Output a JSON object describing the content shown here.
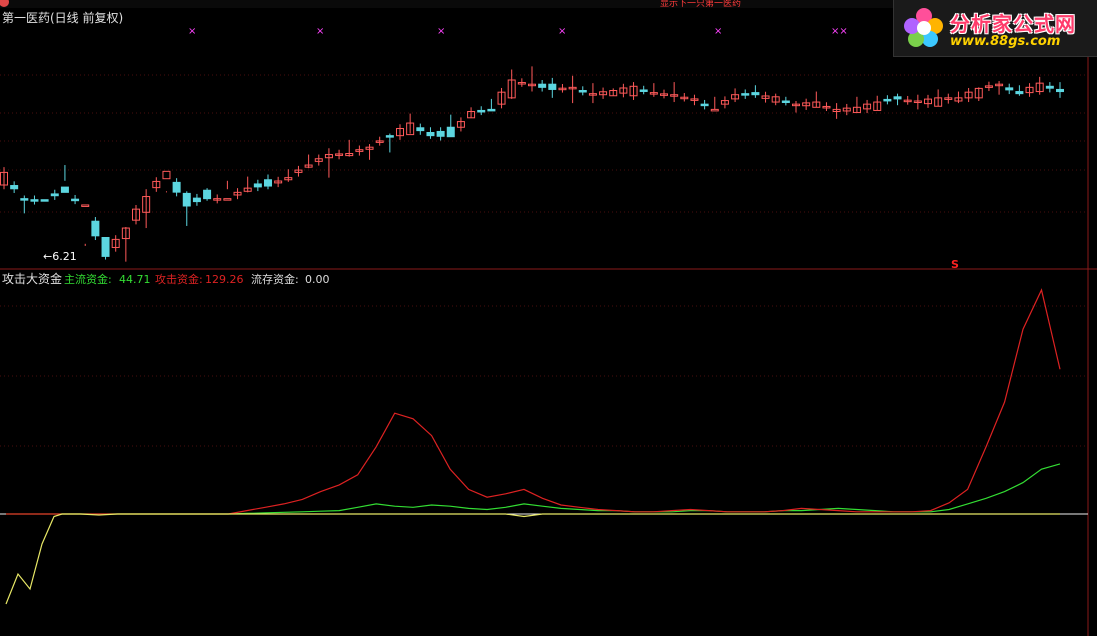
{
  "window": {
    "title": "第一医药(日线 前复权)",
    "top_menu_text": "显示下一只第一医药"
  },
  "logo": {
    "brand": "分析家公式网",
    "url": "www.88gs.com",
    "flower_icon": "flower-logo-icon"
  },
  "price_panel": {
    "low_marker_label": "←6.21",
    "signal_mark": "S",
    "x_marks": [
      "×",
      "×",
      "×",
      "×",
      "×",
      "××"
    ]
  },
  "indicator_panel": {
    "name": "攻击大资金",
    "legend": [
      {
        "label": "主流资金:",
        "value": "44.71",
        "color": "#33dd33"
      },
      {
        "label": "攻击资金:",
        "value": "129.26",
        "color": "#dd2222"
      },
      {
        "label": "流存资金:",
        "value": "0.00",
        "color": "#dddd44"
      }
    ]
  },
  "colors": {
    "up_candle": "#ff5a5a",
    "down_candle": "#5cd6e0",
    "grid": "#3a0000",
    "zero_line": "#ffffff",
    "text": "#e0e0e0",
    "x_mark": "#ff44ff"
  },
  "chart_data": [
    {
      "type": "candlestick",
      "title": "第一医药(日线 前复权)",
      "annotations": [
        "6.21"
      ],
      "candles": [
        [
          0,
          0.0,
          0.12,
          -0.04,
          0.17
        ],
        [
          1,
          -0.13,
          -0.14,
          -0.1,
          -0.27
        ],
        [
          2,
          -0.14,
          -0.15,
          -0.04,
          -0.04
        ],
        [
          3,
          -0.02,
          -0.07,
          0.19,
          0.04
        ],
        [
          4,
          -0.2,
          -0.19,
          -0.58,
          -0.56
        ],
        [
          5,
          -0.5,
          -0.68,
          -0.5,
          -0.71
        ],
        [
          6,
          -0.51,
          -0.41,
          -0.4,
          -0.73
        ],
        [
          7,
          -0.26,
          -0.11,
          -0.04,
          -0.41
        ],
        [
          8,
          0.06,
          0.13,
          -0.07,
          -0.06
        ],
        [
          9,
          -0.08,
          -0.2,
          -0.06,
          -0.39
        ],
        [
          10,
          -0.05,
          -0.13,
          -0.03,
          -0.15
        ],
        [
          11,
          -0.14,
          -0.13,
          0.04,
          -0.04
        ],
        [
          12,
          -0.06,
          -0.03,
          0.08,
          -0.07
        ],
        [
          13,
          0.05,
          -0.01,
          0.1,
          -0.04
        ],
        [
          14,
          0.05,
          0.07,
          0.15,
          0.03
        ],
        [
          15,
          0.17,
          0.19,
          0.29,
          0.16
        ],
        [
          16,
          0.26,
          0.29,
          0.35,
          0.07
        ],
        [
          17,
          0.28,
          0.3,
          0.43,
          0.27
        ],
        [
          18,
          0.34,
          0.36,
          0.39,
          0.24
        ],
        [
          19,
          0.47,
          0.46,
          0.49,
          0.31
        ],
        [
          20,
          0.48,
          0.59,
          0.68,
          0.49
        ],
        [
          21,
          0.5,
          0.47,
          0.55,
          0.44
        ],
        [
          22,
          0.55,
          0.46,
          0.67,
          0.55
        ],
        [
          23,
          0.64,
          0.7,
          0.74,
          0.64
        ],
        [
          24,
          0.72,
          0.71,
          0.82,
          0.71
        ],
        [
          25,
          0.83,
          1.0,
          1.1,
          0.82
        ],
        [
          26,
          0.95,
          0.96,
          1.13,
          0.89
        ],
        [
          27,
          0.96,
          0.91,
          1.02,
          0.83
        ],
        [
          28,
          0.93,
          0.93,
          1.04,
          0.78
        ],
        [
          29,
          0.87,
          0.87,
          0.97,
          0.78
        ],
        [
          30,
          0.85,
          0.9,
          0.92,
          0.85
        ],
        [
          31,
          0.85,
          0.94,
          0.98,
          0.81
        ],
        [
          32,
          0.87,
          0.88,
          0.97,
          0.84
        ],
        [
          33,
          0.85,
          0.86,
          0.98,
          0.79
        ],
        [
          34,
          0.81,
          0.82,
          0.86,
          0.76
        ],
        [
          35,
          0.72,
          0.72,
          0.84,
          0.72
        ],
        [
          36,
          0.82,
          0.86,
          0.92,
          0.79
        ],
        [
          37,
          0.88,
          0.86,
          0.95,
          0.83
        ],
        [
          38,
          0.79,
          0.84,
          0.87,
          0.76
        ],
        [
          39,
          0.76,
          0.77,
          0.8,
          0.69
        ],
        [
          40,
          0.74,
          0.79,
          0.89,
          0.74
        ],
        [
          41,
          0.7,
          0.72,
          0.78,
          0.63
        ],
        [
          42,
          0.69,
          0.74,
          0.84,
          0.69
        ],
        [
          43,
          0.71,
          0.79,
          0.85,
          0.71
        ],
        [
          44,
          0.84,
          0.82,
          0.87,
          0.76
        ],
        [
          45,
          0.79,
          0.8,
          0.86,
          0.72
        ],
        [
          46,
          0.75,
          0.83,
          0.91,
          0.75
        ],
        [
          47,
          0.8,
          0.83,
          0.89,
          0.78
        ],
        [
          48,
          0.83,
          0.92,
          0.93,
          0.8
        ],
        [
          49,
          0.95,
          0.96,
          0.99,
          0.86
        ],
        [
          50,
          0.89,
          0.87,
          0.95,
          0.85
        ],
        [
          51,
          0.89,
          0.97,
          1.03,
          0.86
        ],
        [
          52,
          0.91,
          0.89,
          0.98,
          0.83
        ]
      ]
    },
    {
      "type": "line",
      "title": "攻击大资金",
      "series": [
        {
          "name": "主流资金",
          "values": [
            0,
            0,
            0,
            0,
            0,
            0,
            0,
            0,
            0,
            0,
            0,
            0,
            0,
            0,
            0,
            0.5,
            1,
            1.5,
            2,
            2.5,
            3,
            6,
            9,
            7,
            6,
            8,
            7,
            5,
            4,
            6,
            9,
            7,
            5,
            4,
            3,
            3,
            2,
            2,
            2,
            3,
            3,
            2,
            2,
            2,
            3,
            3,
            4,
            5,
            4,
            3,
            2,
            2,
            2,
            4,
            9,
            14,
            20,
            28,
            40,
            44.71
          ]
        },
        {
          "name": "攻击资金",
          "values": [
            0,
            0,
            0,
            0,
            0,
            0,
            0,
            0,
            0,
            0,
            0,
            0,
            0,
            0,
            0,
            3,
            6,
            9,
            13,
            20,
            26,
            35,
            60,
            90,
            85,
            70,
            40,
            22,
            15,
            18,
            22,
            14,
            8,
            6,
            4,
            3,
            2,
            2,
            3,
            4,
            3,
            2,
            2,
            2,
            3,
            5,
            4,
            3,
            2,
            2,
            2,
            2,
            3,
            10,
            22,
            60,
            100,
            165,
            200,
            129.26
          ]
        },
        {
          "name": "流存资金",
          "values": [
            -180,
            -120,
            -150,
            -60,
            -5,
            0,
            0,
            -2,
            0,
            0,
            0,
            0,
            0,
            0,
            0,
            0,
            0,
            0,
            0,
            0,
            0,
            0,
            0,
            0,
            0,
            0,
            0,
            0,
            0,
            0,
            -5,
            0,
            0,
            0,
            0,
            0,
            0,
            0,
            0,
            0,
            0,
            0,
            0,
            0,
            0,
            0,
            0,
            0,
            0,
            0,
            0,
            0,
            0,
            0,
            0,
            0,
            0,
            0,
            0,
            0
          ]
        }
      ]
    }
  ]
}
